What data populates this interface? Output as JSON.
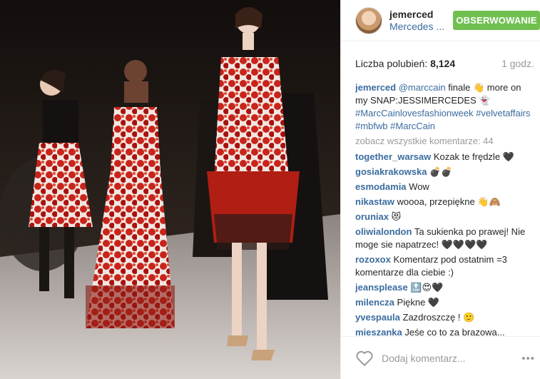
{
  "header": {
    "username": "jemerced",
    "location": "Mercedes ...",
    "follow_label": "OBSERWOWANIE"
  },
  "stats": {
    "likes_label": "Liczba polubień:",
    "likes_count": "8,124",
    "time_ago": "1 godz."
  },
  "caption": {
    "user": "jemerced",
    "mention": "@marccain",
    "text1": " finale 👋 more on my SNAP:JESSIMERCEDES 👻",
    "hashtag1": "#MarcCainlovesfashionweek",
    "hashtag2": "#velvetaffairs",
    "hashtag3": "#mbfwb",
    "hashtag4": "#MarcCain"
  },
  "view_all": "zobacz wszystkie komentarze: 44",
  "comments": [
    {
      "user": "together_warsaw",
      "text": "Kozak te frędzle 🖤"
    },
    {
      "user": "gosiakrakowska",
      "text": "💣💣"
    },
    {
      "user": "esmodamia",
      "text": "Wow"
    },
    {
      "user": "nikastaw",
      "text": "woooa, przepiękne 👋🙈"
    },
    {
      "user": "oruniax",
      "text": "😻"
    },
    {
      "user": "oliwialondon",
      "text": "Ta sukienka po prawej! Nie moge sie napatrzec! 🖤🖤🖤🖤"
    },
    {
      "user": "rozoxox",
      "text": "Komentarz pod ostatnim =3 komentarze dla ciebie :)"
    },
    {
      "user": "jeansplease",
      "text": "🔝😍🖤"
    },
    {
      "user": "milencza",
      "text": "Piękne 🖤"
    },
    {
      "user": "yvespaula",
      "text": "Zazdroszczę ! 🙂"
    },
    {
      "user": "mieszanka",
      "text": "Jeśe co to za brązowa..."
    }
  ],
  "footer": {
    "add_comment_placeholder": "Dodaj komentarz...",
    "more_icon": "more-options-icon",
    "heart_icon": "heart-icon"
  },
  "colors": {
    "accent_link": "#3b6c9e",
    "follow_button": "#70c050"
  }
}
